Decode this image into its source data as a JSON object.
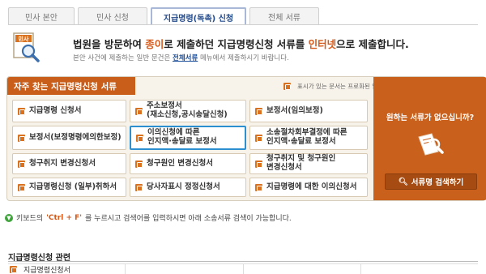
{
  "tabs": [
    {
      "label": "민사 본안"
    },
    {
      "label": "민사 신청"
    },
    {
      "label": "지급명령(독촉) 신청"
    },
    {
      "label": "전체 서류"
    }
  ],
  "banner": {
    "title_pre": "법원을 방문하여 ",
    "title_hl1": "종이",
    "title_mid": "로 제출하던 지급명령신청 서류를 ",
    "title_hl2": "인터넷",
    "title_post": "으로 제출합니다.",
    "sub_pre": "본안 사건에 제출하는 일반 문건은 ",
    "sub_link": "전체서류",
    "sub_post": " 메뉴에서 제출하시기 바랍니다."
  },
  "panel": {
    "title": "자주 찾는 지급명령신청 서류",
    "note": "표시가 있는 문서는 프로화된 입력항목을 직접 작성하는 전자문서입니다.",
    "forms": [
      [
        "지급명령 신청서",
        "주소보정서\n(재소신청,공시송달신청)",
        "보정서(임의보정)"
      ],
      [
        "보정서(보정명령에의한보정)",
        "이의신청에 따른\n인지액·송달료 보정서",
        "소송절차회부결정에 따른\n인지액·송달료 보정서"
      ],
      [
        "청구취지 변경신청서",
        "청구원인 변경신청서",
        "청구취지 및 청구원인\n변경신청서"
      ],
      [
        "지급명령신청 (일부)취하서",
        "당사자표시 정정신청서",
        "지급명령에 대한 이의신청서"
      ]
    ],
    "side_question": "원하는 서류가 없으십니까?",
    "search_button": "서류명 검색하기"
  },
  "hint": {
    "pre": "키보드의 ",
    "key": "'Ctrl + F'",
    "post": "를 누르시고 검색어를 입력하시면 아래 소송서류 검색이 가능합니다."
  },
  "related": {
    "title": "지급명령신청 관련",
    "items": [
      "지급명령신청서",
      "",
      "",
      ""
    ]
  },
  "colors": {
    "accent": "#c95e1b",
    "highlight": "#d55a1a",
    "selected_border": "#2c8fd0",
    "panel_bg": "#f7f2ea"
  }
}
